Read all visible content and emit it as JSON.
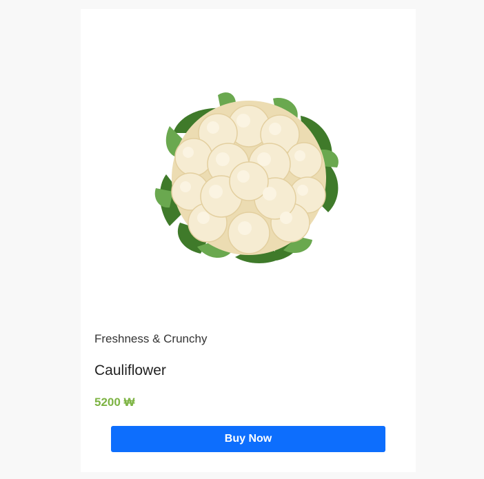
{
  "product": {
    "image_name": "cauliflower-image",
    "tagline": "Freshness & Crunchy",
    "name": "Cauliflower",
    "price": "5200 ₩",
    "buy_label": "Buy Now"
  },
  "colors": {
    "page_background": "#f8f8f8",
    "card_background": "#ffffff",
    "price_color": "#7cb342",
    "button_color": "#0d6efd",
    "button_text": "#ffffff"
  }
}
